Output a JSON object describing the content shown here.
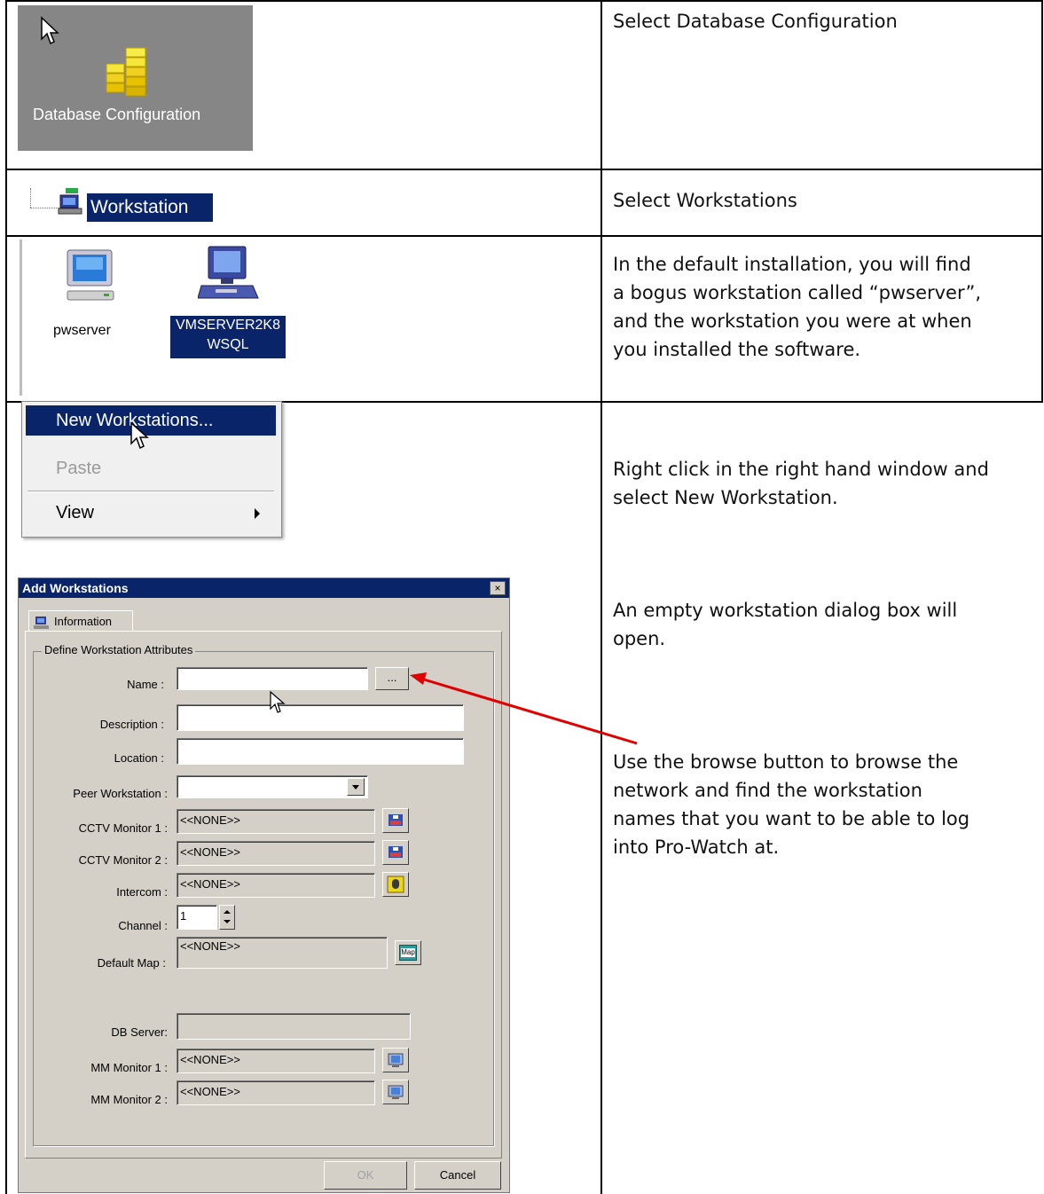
{
  "rows": [
    {
      "instruction": "Select Database Configuration"
    },
    {
      "instruction": "Select Workstations"
    },
    {
      "instruction_lines": [
        "In the default installation, you will find",
        "a bogus workstation called “pwserver”,",
        "and the workstation you were at when",
        "you installed the software."
      ]
    },
    {
      "instruction_lines": [
        "Right click in the right hand window and",
        "select New Workstation."
      ]
    }
  ],
  "notes": {
    "dialog_open_lines": [
      "An empty workstation dialog box will",
      "open."
    ],
    "browse_lines": [
      "Use the browse button to browse the",
      "network and find the workstation",
      "names that you want to be able to log",
      "into Pro-Watch at."
    ]
  },
  "screens": {
    "db_config_label": "Database Configuration",
    "tree_item": "Workstation",
    "workstation_icons": [
      {
        "label": "pwserver"
      },
      {
        "label_lines": [
          "VMSERVER2K8",
          "WSQL"
        ]
      }
    ],
    "context_menu": [
      "New Workstations...",
      "Paste",
      "View"
    ]
  },
  "dialog": {
    "title": "Add Workstations",
    "close_glyph": "×",
    "tab": "Information",
    "group_title": "Define Workstation Attributes",
    "fields": {
      "name": {
        "label": "Name :",
        "value": ""
      },
      "browse_label": "...",
      "description": {
        "label": "Description :",
        "value": ""
      },
      "location": {
        "label": "Location :",
        "value": ""
      },
      "peer": {
        "label": "Peer Workstation :",
        "value": ""
      },
      "cctv1": {
        "label": "CCTV Monitor 1 :",
        "value": "<<NONE>>"
      },
      "cctv2": {
        "label": "CCTV Monitor 2 :",
        "value": "<<NONE>>"
      },
      "intercom": {
        "label": "Intercom :",
        "value": "<<NONE>>"
      },
      "channel": {
        "label": "Channel :",
        "value": "1"
      },
      "default_map": {
        "label": "Default Map :",
        "value": "<<NONE>>"
      },
      "db_server": {
        "label": "DB Server:",
        "value": ""
      },
      "mm1": {
        "label": "MM Monitor 1 :",
        "value": "<<NONE>>"
      },
      "mm2": {
        "label": "MM Monitor 2 :",
        "value": "<<NONE>>"
      }
    },
    "map_icon_text": "Map",
    "ok_label": "OK",
    "cancel_label": "Cancel"
  },
  "colors": {
    "selection": "#0a246a",
    "arrow": "#e00000",
    "dialog_face": "#d4d0c8"
  }
}
